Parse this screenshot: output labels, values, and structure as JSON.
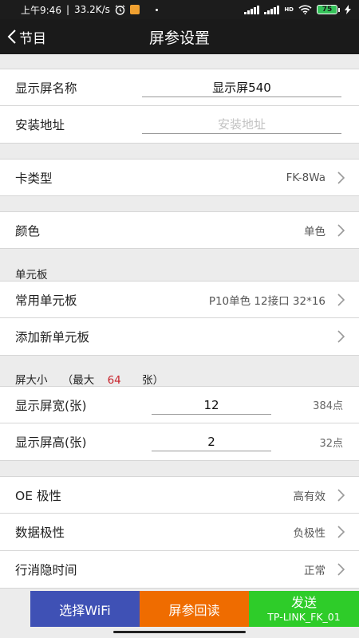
{
  "statusbar": {
    "time": "上午9:46",
    "speed": "33.2K/s",
    "signal_label": "HD",
    "battery": "75"
  },
  "nav": {
    "back_label": "节目",
    "title": "屏参设置"
  },
  "form": {
    "screen_name": {
      "label": "显示屏名称",
      "value": "显示屏540"
    },
    "install_address": {
      "label": "安装地址",
      "placeholder": "安装地址"
    },
    "card_type": {
      "label": "卡类型",
      "value": "FK-8Wa"
    },
    "color": {
      "label": "颜色",
      "value": "单色"
    },
    "unit_board_section": "单元板",
    "common_board": {
      "label": "常用单元板",
      "value": "P10单色 12接口 32*16"
    },
    "add_board": {
      "label": "添加新单元板"
    },
    "size_section": {
      "prefix": "屏大小",
      "max_label": "（最大",
      "max_value": "64",
      "suffix": "张）"
    },
    "width": {
      "label": "显示屏宽(张)",
      "value": "12",
      "unit": "384点"
    },
    "height": {
      "label": "显示屏高(张)",
      "value": "2",
      "unit": "32点"
    },
    "oe_polarity": {
      "label": "OE 极性",
      "value": "高有效"
    },
    "data_polarity": {
      "label": "数据极性",
      "value": "负极性"
    },
    "blanking_time": {
      "label": "行消隐时间",
      "value": "正常"
    }
  },
  "buttons": {
    "select_wifi": "选择WiFi",
    "read_back": "屏参回读",
    "send": "发送",
    "send_target": "TP-LINK_FK_01"
  },
  "colors": {
    "navbar": "#1a1a1a",
    "wifi_button": "#3f51b5",
    "read_button": "#ef6c00",
    "send_button": "#2ecc29",
    "highlight_red": "#c8232c"
  }
}
